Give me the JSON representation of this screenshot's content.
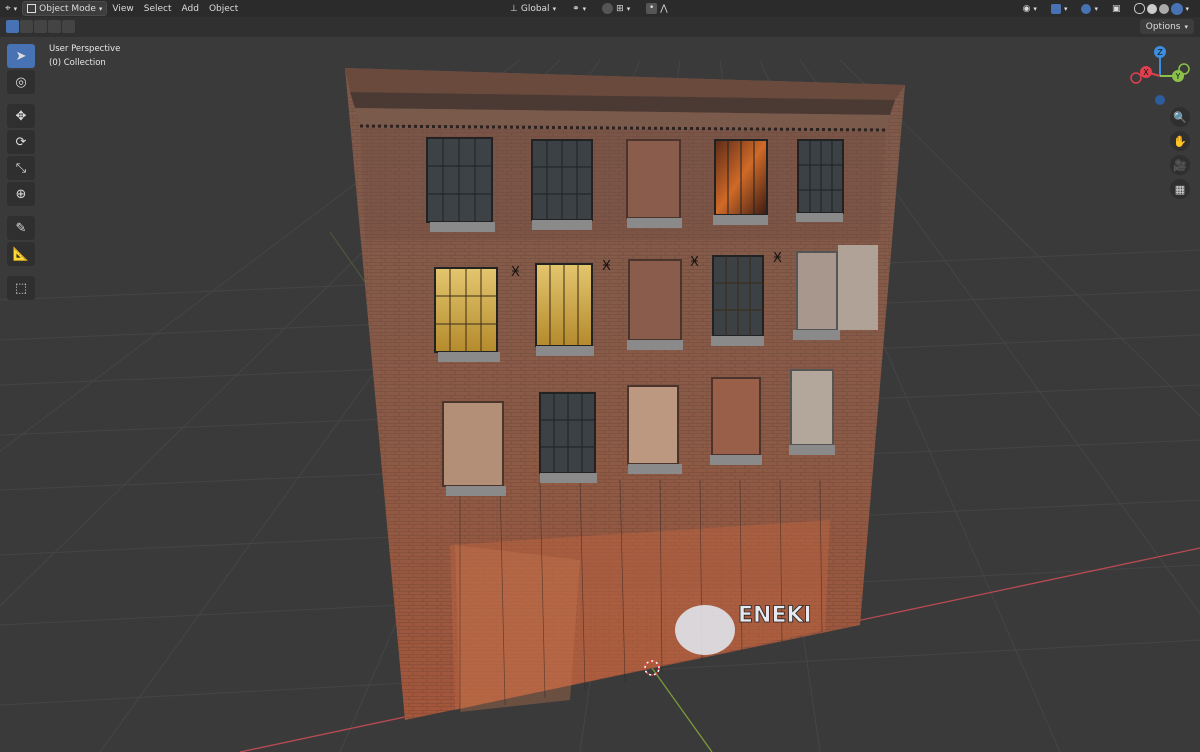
{
  "header": {
    "mode_label": "Object Mode",
    "menus": [
      "View",
      "Select",
      "Add",
      "Object"
    ],
    "orientation_label": "Global",
    "options_label": "Options"
  },
  "viewport": {
    "perspective_label": "User Perspective",
    "collection_label": "(0) Collection",
    "graffiti_text": "ENEKI"
  },
  "colors": {
    "accent": "#4772b3",
    "axis_x": "#e0404d",
    "axis_y": "#8bc34a",
    "axis_z": "#3c8fe0"
  },
  "gizmo": {
    "x": "X",
    "y": "Y",
    "z": "Z"
  },
  "icons": {
    "toolbar": [
      "cursor-select-icon",
      "3d-cursor-icon",
      "move-icon",
      "rotate-icon",
      "scale-icon",
      "transform-icon",
      "annotate-icon",
      "measure-icon",
      "add-cube-icon"
    ],
    "nav": [
      "zoom-icon",
      "pan-hand-icon",
      "camera-icon",
      "grid-ortho-icon"
    ]
  }
}
